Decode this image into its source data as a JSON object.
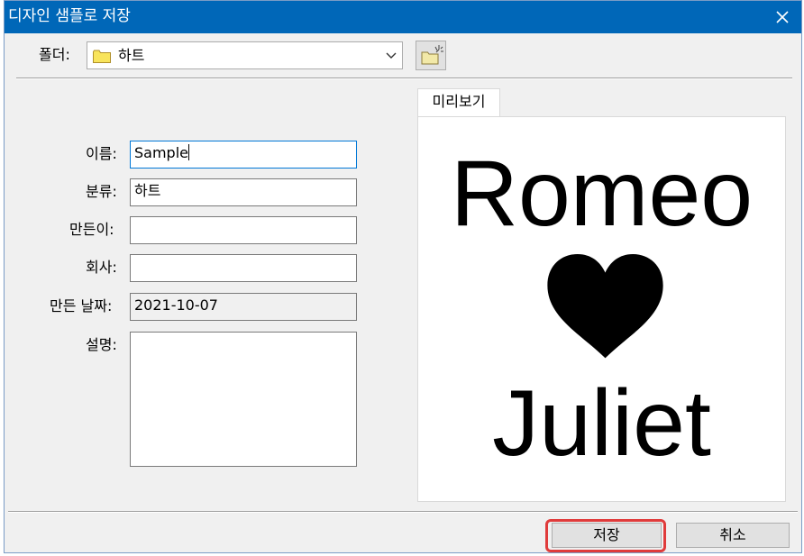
{
  "window": {
    "title": "디자인 샘플로 저장"
  },
  "folder": {
    "label": "폴더:",
    "value": "하트"
  },
  "form": {
    "name_label": "이름:",
    "name_value": "Sample",
    "category_label": "분류:",
    "category_value": "하트",
    "creator_label": "만든이:",
    "creator_value": "",
    "company_label": "회사:",
    "company_value": "",
    "date_label": "만든 날짜:",
    "date_value": "2021-10-07",
    "description_label": "설명:",
    "description_value": ""
  },
  "preview": {
    "tab_label": "미리보기",
    "line1": "Romeo",
    "line2": "Juliet"
  },
  "buttons": {
    "save": "저장",
    "cancel": "취소"
  },
  "colors": {
    "titlebar": "#0067b8",
    "highlight": "#e03b3b",
    "focus_border": "#0078d7"
  },
  "icons": {
    "folder": "folder-icon",
    "new_folder": "new-folder-icon",
    "close": "close-icon",
    "dropdown": "chevron-down-icon",
    "preview_shape": "heart-icon"
  }
}
